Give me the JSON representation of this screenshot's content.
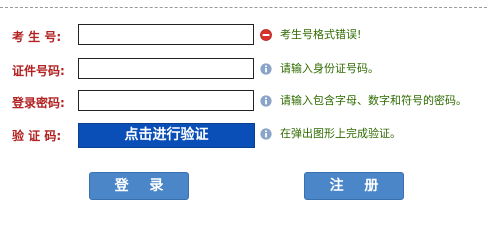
{
  "form": {
    "exam_number": {
      "label": "考 生 号:",
      "value": "",
      "status": "error",
      "message": "考生号格式错误!"
    },
    "id_number": {
      "label": "证件号码:",
      "value": "",
      "status": "info",
      "message": "请输入身份证号码。"
    },
    "password": {
      "label": "登录密码:",
      "value": "",
      "status": "info",
      "message": "请输入包含字母、数字和符号的密码。"
    },
    "verification": {
      "label": "验 证 码:",
      "button_label": "点击进行验证",
      "status": "info",
      "message": "在弹出图形上完成验证。"
    }
  },
  "actions": {
    "login_label": "登 录",
    "register_label": "注 册"
  },
  "icons": {
    "error": "error-circle-icon",
    "info": "info-circle-icon"
  },
  "colors": {
    "label": "#b22222",
    "hint": "#2e6b00",
    "error_icon": "#d9322c",
    "info_icon": "#8aa5c8",
    "verify_button": "#0a4fb8",
    "action_button": "#4a86c8"
  }
}
